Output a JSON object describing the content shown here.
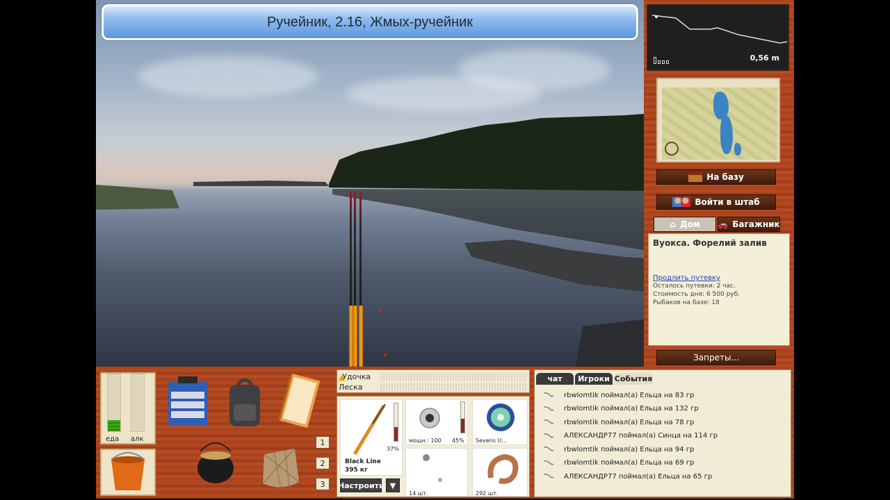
{
  "title": "Ручейник, 2.16, Жмых-ручейник",
  "depth": {
    "value": "0,56 m"
  },
  "nav": {
    "to_base": "На базу",
    "headquarters": "Войти в штаб",
    "home_tab": "Дом",
    "trunk_tab": "Багажник"
  },
  "location": {
    "name": "Вуокса. Форелий залив",
    "extend_link": "Продлить путевку",
    "remaining": "Осталось путевки: 2 час.",
    "cost": "Стоимость дня: 6 500 руб.",
    "fishers": "Рыбаков на базе: 18"
  },
  "bans_button": "Запреты...",
  "stats": {
    "food_label": "еда",
    "alc_label": "алк",
    "food_level": 0.2,
    "alc_level": 0.0
  },
  "slots": [
    "1",
    "2",
    "3"
  ],
  "meters": {
    "rod_label": "Удочка",
    "line_label": "Леска"
  },
  "tackle": {
    "rod_name": "Black Line",
    "rod_strength": "395 кг",
    "rod_wear": "37%",
    "reel_power": "мощн.: 100",
    "reel_wear": "45%",
    "line_name": "Sevens U...",
    "floats_count": "14 шт.",
    "bait_count": "292 шт.",
    "setup_button": "Настроить",
    "dropdown_icon": "▼"
  },
  "chat": {
    "tabs": [
      "чат",
      "Игроки",
      "События"
    ],
    "active_tab": "События",
    "messages": [
      "rbwlomtik поймал(а) Ельца на 83 гр",
      "rbwlomtik поймал(а) Ельца на 132 гр",
      "rbwlomtik поймал(а) Ельца на 78 гр",
      "АЛЕКСАНДР77 поймал(а) Синца на 114 гр",
      "rbwlomtik поймал(а) Ельца на 94 гр",
      "rbwlomtik поймал(а) Ельца на 69 гр",
      "АЛЕКСАНДР77 поймал(а) Ельца на 65 гр"
    ]
  }
}
